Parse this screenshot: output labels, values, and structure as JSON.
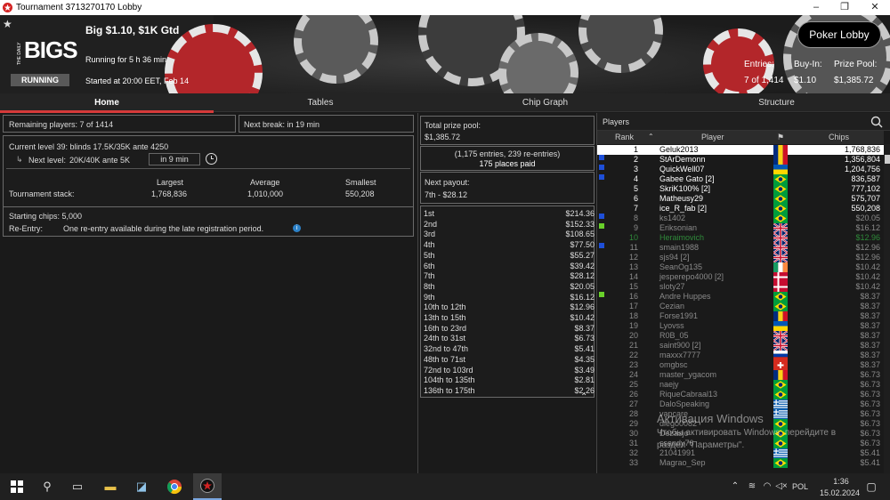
{
  "window": {
    "title": "Tournament 3713270170 Lobby",
    "controls": [
      "–",
      "❐",
      "✕"
    ]
  },
  "banner": {
    "brand_small": "THE DAILY",
    "brand_big": "BIGS",
    "status": "RUNNING",
    "title": "Big $1.10, $1K Gtd",
    "running_for": "Running for 5 h 36 min",
    "started_at": "Started at 20:00 EET, Feb 14",
    "lobby_button": "Poker Lobby",
    "stats": [
      {
        "label": "Entries:",
        "value": "7 of 1,414"
      },
      {
        "label": "Buy-In:",
        "value": "$1.10"
      },
      {
        "label": "Prize Pool:",
        "value": "$1,385.72"
      }
    ]
  },
  "tabs": [
    "Home",
    "Tables",
    "Chip Graph",
    "Structure"
  ],
  "home": {
    "remaining": "Remaining players: 7 of 1414",
    "next_break": "Next break: in 19 min",
    "current_level": "Current level 39:  blinds 17.5K/35K ante 4250",
    "next_level_label": "Next level:",
    "next_level_value": "20K/40K ante 5K",
    "next_level_time": "in 9 min",
    "stack_label": "Tournament stack:",
    "stack_headers": [
      "Largest",
      "Average",
      "Smallest"
    ],
    "stack_values": [
      "1,768,836",
      "1,010,000",
      "550,208"
    ],
    "starting_chips": "Starting chips:  5,000",
    "reentry_label": "Re-Entry:",
    "reentry_text": "One re-entry available during the late registration period."
  },
  "prizes": {
    "total_label": "Total prize pool:",
    "total_value": "$1,385.72",
    "entries_info": "(1,175 entries, 239 re-entries)",
    "places_paid": "175 places paid",
    "next_payout_label": "Next payout:",
    "next_payout_value": "7th - $28.12",
    "rows": [
      [
        "1st",
        "$214.36"
      ],
      [
        "2nd",
        "$152.33"
      ],
      [
        "3rd",
        "$108.65"
      ],
      [
        "4th",
        "$77.50"
      ],
      [
        "5th",
        "$55.27"
      ],
      [
        "6th",
        "$39.42"
      ],
      [
        "7th",
        "$28.12"
      ],
      [
        "8th",
        "$20.05"
      ],
      [
        "9th",
        "$16.12"
      ],
      [
        "10th to 12th",
        "$12.96"
      ],
      [
        "13th to 15th",
        "$10.42"
      ],
      [
        "16th to 23rd",
        "$8.37"
      ],
      [
        "24th to 31st",
        "$6.73"
      ],
      [
        "32nd to 47th",
        "$5.41"
      ],
      [
        "48th to 71st",
        "$4.35"
      ],
      [
        "72nd to 103rd",
        "$3.49"
      ],
      [
        "104th to 135th",
        "$2.81"
      ],
      [
        "136th to 175th",
        "$2.26"
      ]
    ]
  },
  "players": {
    "header": "Players",
    "columns": [
      "Rank",
      "Player",
      "Chips"
    ],
    "rows": [
      {
        "rank": "1",
        "name": "Geluk2013",
        "chips": "1,768,836",
        "flag": "ro",
        "state": "selected"
      },
      {
        "rank": "2",
        "name": "StArDemonn",
        "chips": "1,356,804",
        "flag": "ro",
        "state": "active",
        "sq": "#1e4fd8"
      },
      {
        "rank": "3",
        "name": "QuickWell07",
        "chips": "1,204,756",
        "flag": "ua",
        "state": "active",
        "sq": "#1e4fd8"
      },
      {
        "rank": "4",
        "name": "Gabee Gato [2]",
        "chips": "836,587",
        "flag": "br",
        "state": "active",
        "sq": "#1e4fd8"
      },
      {
        "rank": "5",
        "name": "SkriK100% [2]",
        "chips": "777,102",
        "flag": "br",
        "state": "active"
      },
      {
        "rank": "6",
        "name": "Matheusy29",
        "chips": "575,707",
        "flag": "br",
        "state": "active"
      },
      {
        "rank": "7",
        "name": "ice_R_fab [2]",
        "chips": "550,208",
        "flag": "br",
        "state": "active"
      },
      {
        "rank": "8",
        "name": "ks1402",
        "chips": "$20.05",
        "flag": "br",
        "state": "out",
        "sq": "#1e4fd8"
      },
      {
        "rank": "9",
        "name": "Eriksonian",
        "chips": "$16.12",
        "flag": "gb",
        "state": "out",
        "sq": "#69d02a"
      },
      {
        "rank": "10",
        "name": "Heraimovich",
        "chips": "$12.96",
        "flag": "gb",
        "state": "green"
      },
      {
        "rank": "11",
        "name": "smain1988",
        "chips": "$12.96",
        "flag": "gb",
        "state": "out",
        "sq": "#1e4fd8"
      },
      {
        "rank": "12",
        "name": "sjs94 [2]",
        "chips": "$12.96",
        "flag": "gb",
        "state": "out"
      },
      {
        "rank": "13",
        "name": "SeanOg135",
        "chips": "$10.42",
        "flag": "ie",
        "state": "out"
      },
      {
        "rank": "14",
        "name": "jesperepo4000 [2]",
        "chips": "$10.42",
        "flag": "dk",
        "state": "out"
      },
      {
        "rank": "15",
        "name": "sloty27",
        "chips": "$10.42",
        "flag": "dk",
        "state": "out"
      },
      {
        "rank": "16",
        "name": "Andre Huppes",
        "chips": "$8.37",
        "flag": "br",
        "state": "out",
        "sq": "#69d02a"
      },
      {
        "rank": "17",
        "name": "Cezian",
        "chips": "$8.37",
        "flag": "br",
        "state": "out"
      },
      {
        "rank": "18",
        "name": "Forse1991",
        "chips": "$8.37",
        "flag": "ro",
        "state": "out"
      },
      {
        "rank": "19",
        "name": "Lyovss",
        "chips": "$8.37",
        "flag": "ua",
        "state": "out"
      },
      {
        "rank": "20",
        "name": "R0B_05",
        "chips": "$8.37",
        "flag": "gb",
        "state": "out"
      },
      {
        "rank": "21",
        "name": "saint900 [2]",
        "chips": "$8.37",
        "flag": "gb",
        "state": "out"
      },
      {
        "rank": "22",
        "name": "maxxx7777",
        "chips": "$8.37",
        "flag": "ru",
        "state": "out"
      },
      {
        "rank": "23",
        "name": "omgbsc",
        "chips": "$8.37",
        "flag": "ch",
        "state": "out"
      },
      {
        "rank": "24",
        "name": "master_ygacom",
        "chips": "$6.73",
        "flag": "ro",
        "state": "out"
      },
      {
        "rank": "25",
        "name": "naejy",
        "chips": "$6.73",
        "flag": "br",
        "state": "out"
      },
      {
        "rank": "26",
        "name": "RiqueCabraal13",
        "chips": "$6.73",
        "flag": "br",
        "state": "out"
      },
      {
        "rank": "27",
        "name": "DaloSpeaking",
        "chips": "$6.73",
        "flag": "gr",
        "state": "out"
      },
      {
        "rank": "28",
        "name": "vapcare",
        "chips": "$6.73",
        "flag": "gr",
        "state": "out"
      },
      {
        "rank": "29",
        "name": "diego0082",
        "chips": "$6.73",
        "flag": "br",
        "state": "out"
      },
      {
        "rank": "30",
        "name": "Dezasjo",
        "chips": "$6.73",
        "flag": "br",
        "state": "out"
      },
      {
        "rank": "31",
        "name": "ssandy76",
        "chips": "$6.73",
        "flag": "br",
        "state": "out"
      },
      {
        "rank": "32",
        "name": "21041991",
        "chips": "$5.41",
        "flag": "gr",
        "state": "out"
      },
      {
        "rank": "33",
        "name": "Magrao_Sep",
        "chips": "$5.41",
        "flag": "br",
        "state": "out"
      }
    ]
  },
  "watermark": {
    "line1": "Активация Windows",
    "line2": "Чтобы активировать Windows, перейдите в",
    "line3": "раздел \"Параметры\"."
  },
  "taskbar": {
    "time": "1:36",
    "date": "15.02.2024",
    "lang": "POL"
  },
  "colors": {
    "accent": "#d63a3a",
    "selected_bg": "#ffffff",
    "active_text": "#ffffff",
    "out_text": "#8a8a8a",
    "green_text": "#2f8a3a"
  }
}
